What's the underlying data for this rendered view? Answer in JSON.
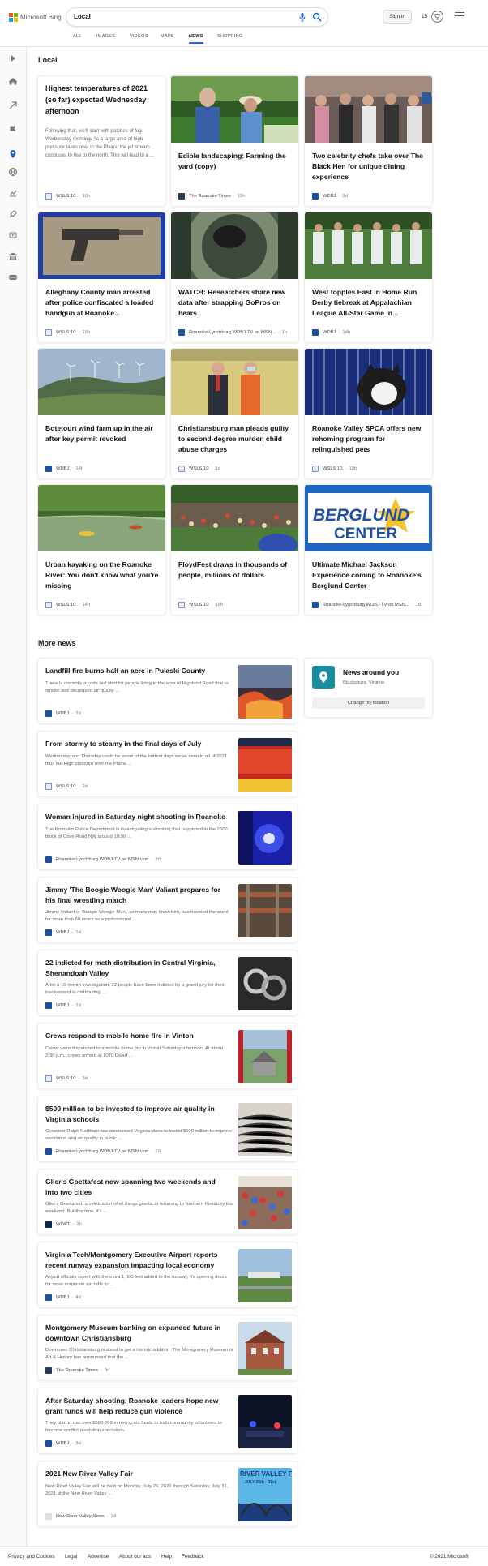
{
  "brand": {
    "name": "Microsoft Bing",
    "colors": [
      "#f25022",
      "#7fba00",
      "#00a4ef",
      "#ffb900"
    ]
  },
  "search": {
    "query": "Local"
  },
  "header": {
    "signin": "Sign in",
    "rewards_count": "15"
  },
  "tabs": [
    {
      "label": "ALL"
    },
    {
      "label": "IMAGES"
    },
    {
      "label": "VIDEOS"
    },
    {
      "label": "MAPS"
    },
    {
      "label": "NEWS",
      "active": true
    },
    {
      "label": "SHOPPING"
    }
  ],
  "sections": {
    "local": "Local",
    "more_news": "More news"
  },
  "local_cards": [
    {
      "title": "Highest temperatures of 2021 (so far) expected Wednesday afternoon",
      "snippet": "Following that, we'll start with patches of fog Wednesday morning. As a large area of high pressure takes over in the Plains, the jet stream continues to rise to the north. This will lead to a ...",
      "source": "WSLS 10",
      "age": "10h"
    },
    {
      "title": "Edible landscaping: Farming the yard (copy)",
      "source": "The Roanoke Times",
      "age": "13h"
    },
    {
      "title": "Two celebrity chefs take over The Black Hen for unique dining experience",
      "source": "WDBJ",
      "age": "3d"
    },
    {
      "title": "Alleghany County man arrested after police confiscated a loaded handgun at Roanoke...",
      "source": "WSLS 10",
      "age": "15h"
    },
    {
      "title": "WATCH: Researchers share new data after strapping GoPros on bears",
      "source": "Roanoke-Lynchburg WDBJ-TV on MSN...",
      "age": "1h"
    },
    {
      "title": "West topples East in Home Run Derby tiebreak at Appalachian League All-Star Game in...",
      "source": "WDBJ",
      "age": "14h"
    },
    {
      "title": "Botetourt wind farm up in the air after key permit revoked",
      "source": "WDBJ",
      "age": "14h"
    },
    {
      "title": "Christiansburg man pleads guilty to second-degree murder, child abuse charges",
      "source": "WSLS 10",
      "age": "1d"
    },
    {
      "title": "Roanoke Valley SPCA offers new rehoming program for relinquished pets",
      "source": "WSLS 10",
      "age": "19h"
    },
    {
      "title": "Urban kayaking on the Roanoke River: You don't know what you're missing",
      "source": "WSLS 10",
      "age": "14h"
    },
    {
      "title": "FloydFest draws in thousands of people, millions of dollars",
      "source": "WSLS 10",
      "age": "19h"
    },
    {
      "title": "Ultimate Michael Jackson Experience coming to Roanoke's Berglund Center",
      "source": "Roanoke-Lynchburg WDBJ-TV on MSN...",
      "age": "1d",
      "image_text": [
        "BERGLUND",
        "CENTER"
      ]
    }
  ],
  "news_around": {
    "title": "News around you",
    "location": "Blacksburg, Virginia",
    "button": "Change my location"
  },
  "more_news": [
    {
      "title": "Landfill fire burns half an acre in Pulaski County",
      "snippet": "There is currently a code red alert for people living in the area of Highland Road due to smoke and decreased air quality ...",
      "source": "WDBJ",
      "age": "2d"
    },
    {
      "title": "From stormy to steamy in the final days of July",
      "snippet": "Wednesday and Thursday could be some of the hottest days we've seen in all of 2021 thus far. High pressure over the Plains ...",
      "source": "WSLS 10",
      "age": "2d"
    },
    {
      "title": "Woman injured in Saturday night shooting in Roanoke",
      "snippet": "The Roanoke Police Department is investigating a shooting that happened in the 2600 block of Cove Road NW around 10:30 ...",
      "source": "Roanoke-Lynchburg WDBJ-TV on MSN.com",
      "age": "3d"
    },
    {
      "title": "Jimmy 'The Boogie Woogie Man' Valiant prepares for his final wrestling match",
      "snippet": "Jimmy Valiant or 'Boogie Woogie Man', as many may know him, has traveled the world for more than 50 years as a professional ...",
      "source": "WDBJ",
      "age": "1d"
    },
    {
      "title": "22 indicted for meth distribution in Central Virginia, Shenandoah Valley",
      "snippet": "After a 10-month investigation, 22 people have been indicted by a grand jury for their involvement in distributing ...",
      "source": "WDBJ",
      "age": "1d"
    },
    {
      "title": "Crews respond to mobile home fire in Vinton",
      "snippet": "Crews were dispatched to a mobile home fire in Vinton Saturday afternoon. At about 2:30 p.m., crews arrived at 1070 Dwarf ...",
      "source": "WSLS 10",
      "age": "3d"
    },
    {
      "title": "$500 million to be invested to improve air quality in Virginia schools",
      "snippet": "Governor Ralph Northam has announced Virginia plans to invest $500 million to improve ventilation and air quality in public ...",
      "source": "Roanoke-Lynchburg WDBJ-TV on MSN.com",
      "age": "2d"
    },
    {
      "title": "Glier's Goettafest now spanning two weekends and into two cities",
      "snippet": "Glier's Goettafest, a celebration of all things goetta, is returning to Northern Kentucky this weekend. But this time, it's ...",
      "source": "WLWT",
      "age": "2h"
    },
    {
      "title": "Virginia Tech/Montgomery Executive Airport reports recent runway expansion impacting local economy",
      "snippet": "Airport officials report with the extra 1,000 feet added to the runway, it's opening doors for more corporate aircrafts to ...",
      "source": "WDBJ",
      "age": "4d"
    },
    {
      "title": "Montgomery Museum banking on expanded future in downtown Christiansburg",
      "snippet": "Downtown Christiansburg is about to get a historic addition. The Montgomery Museum of Art & History has announced that the ...",
      "source": "The Roanoke Times",
      "age": "3d"
    },
    {
      "title": "After Saturday shooting, Roanoke leaders hope new grant funds will help reduce gun violence",
      "snippet": "They plan to use over $500,000 in new grant funds to train community volunteers to become conflict resolution specialists.",
      "source": "WDBJ",
      "age": "3d"
    },
    {
      "title": "2021 New River Valley Fair",
      "snippet": "New River Valley Fair will be held on Monday, July 26, 2021 through Saturday, July 31, 2021 at the New River Valley ...",
      "source": "New River Valley News",
      "age": "2d",
      "image_text": [
        "RIVER VALLEY F",
        "JULY 26th - 31st"
      ]
    }
  ],
  "footer": {
    "links": [
      "Privacy and Cookies",
      "Legal",
      "Advertise",
      "About our ads",
      "Help",
      "Feedback"
    ],
    "copyright": "© 2021 Microsoft"
  }
}
